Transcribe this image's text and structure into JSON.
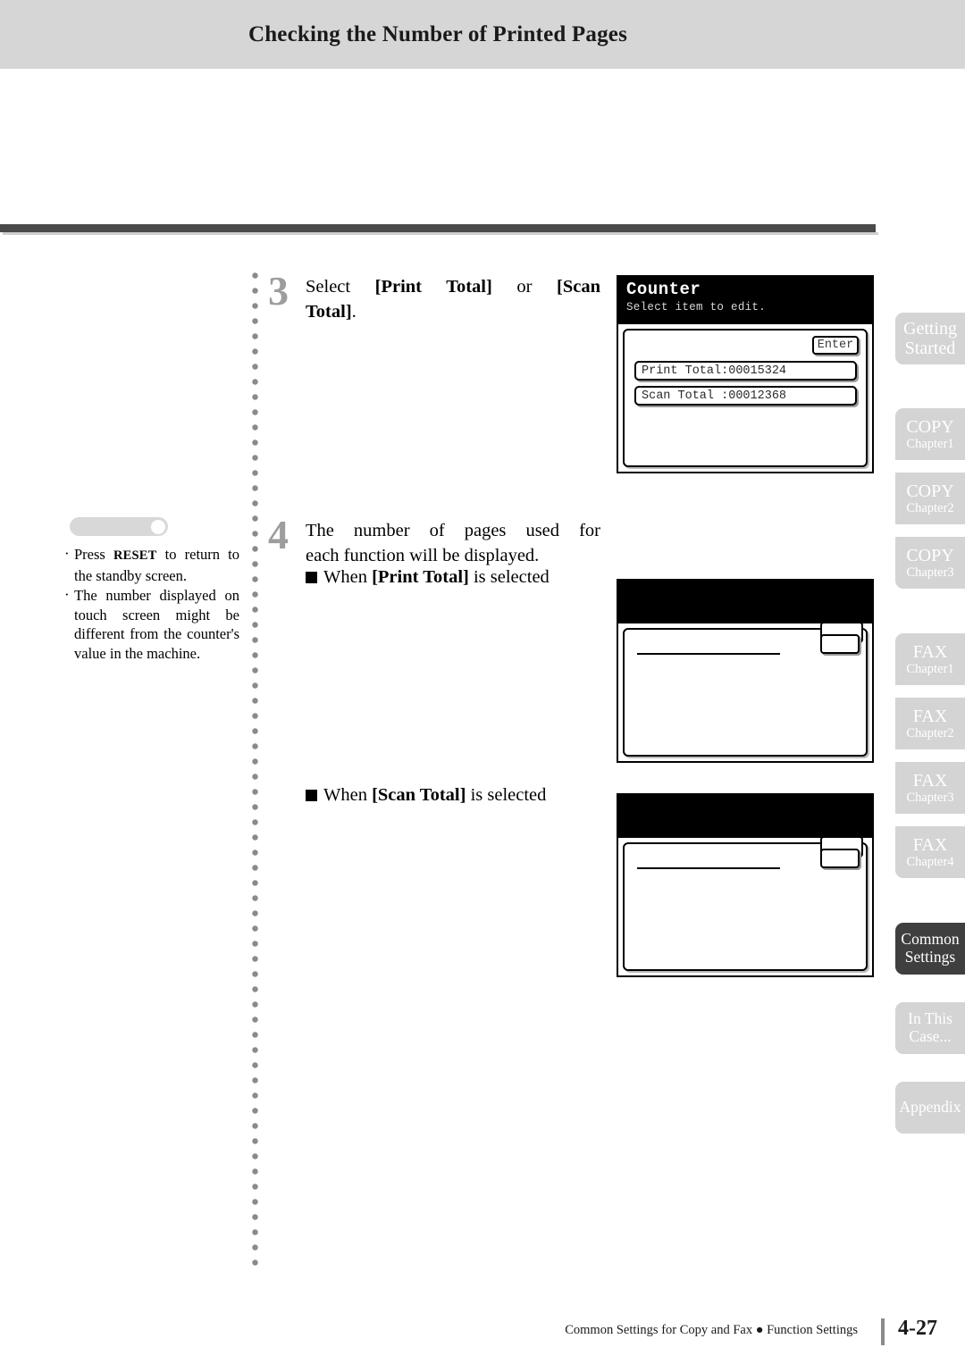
{
  "header": {
    "title": "Checking the Number of Printed Pages"
  },
  "steps": [
    {
      "number": "3",
      "line1_a": "Select ",
      "line1_b": "[Print Total]",
      "line1_c": " or ",
      "line1_d": "[Scan",
      "line2_b": "Total]",
      "line2_c": "."
    },
    {
      "number": "4",
      "line1": "The number of pages used for",
      "line2": "each function will be displayed."
    }
  ],
  "bullets": {
    "print": {
      "prefix": "When ",
      "bold": "[Print Total]",
      "suffix": " is selected"
    },
    "scan": {
      "prefix": "When ",
      "bold": "[Scan Total]",
      "suffix": " is selected"
    }
  },
  "note": {
    "items": [
      {
        "prefix": "Press ",
        "bold": "RESET",
        "suffix": " to return to the standby screen."
      },
      {
        "prefix": "",
        "bold": "",
        "suffix": "The number displayed on touch screen might be different from the counter's value in the machine."
      }
    ]
  },
  "counter_screen": {
    "title": "Counter",
    "subtitle": "Select item to edit.",
    "enter_label": "Enter",
    "rows": [
      "Print Total:00015324",
      "Scan Total :00012368"
    ]
  },
  "blank_screens": [
    {
      "name": "print-total-result-screen"
    },
    {
      "name": "scan-total-result-screen"
    }
  ],
  "sidebar": {
    "tabs": [
      {
        "main": "Getting",
        "sub": "Started",
        "active": false,
        "style": "two-line-plain"
      },
      {
        "main": "COPY",
        "sub": "Chapter1",
        "active": false,
        "style": "chapter"
      },
      {
        "main": "COPY",
        "sub": "Chapter2",
        "active": false,
        "style": "chapter"
      },
      {
        "main": "COPY",
        "sub": "Chapter3",
        "active": false,
        "style": "chapter"
      },
      {
        "main": "FAX",
        "sub": "Chapter1",
        "active": false,
        "style": "chapter"
      },
      {
        "main": "FAX",
        "sub": "Chapter2",
        "active": false,
        "style": "chapter"
      },
      {
        "main": "FAX",
        "sub": "Chapter3",
        "active": false,
        "style": "chapter"
      },
      {
        "main": "FAX",
        "sub": "Chapter4",
        "active": false,
        "style": "chapter"
      },
      {
        "main": "Common",
        "sub": "Settings",
        "active": true,
        "style": "two-line-plain"
      },
      {
        "main": "In This",
        "sub": "Case...",
        "active": false,
        "style": "two-line-plain"
      },
      {
        "main": "Appendix",
        "sub": "",
        "active": false,
        "style": "single"
      }
    ]
  },
  "footer": {
    "text": "Common Settings for Copy and Fax ● Function Settings",
    "page": "4-27"
  },
  "colors": {
    "header_band": "#d6d6d6",
    "rule": "#4a4a4a",
    "tab_inactive": "#d4d4d4",
    "tab_active": "#3f3f3f",
    "step_number": "#9d9d9d"
  }
}
